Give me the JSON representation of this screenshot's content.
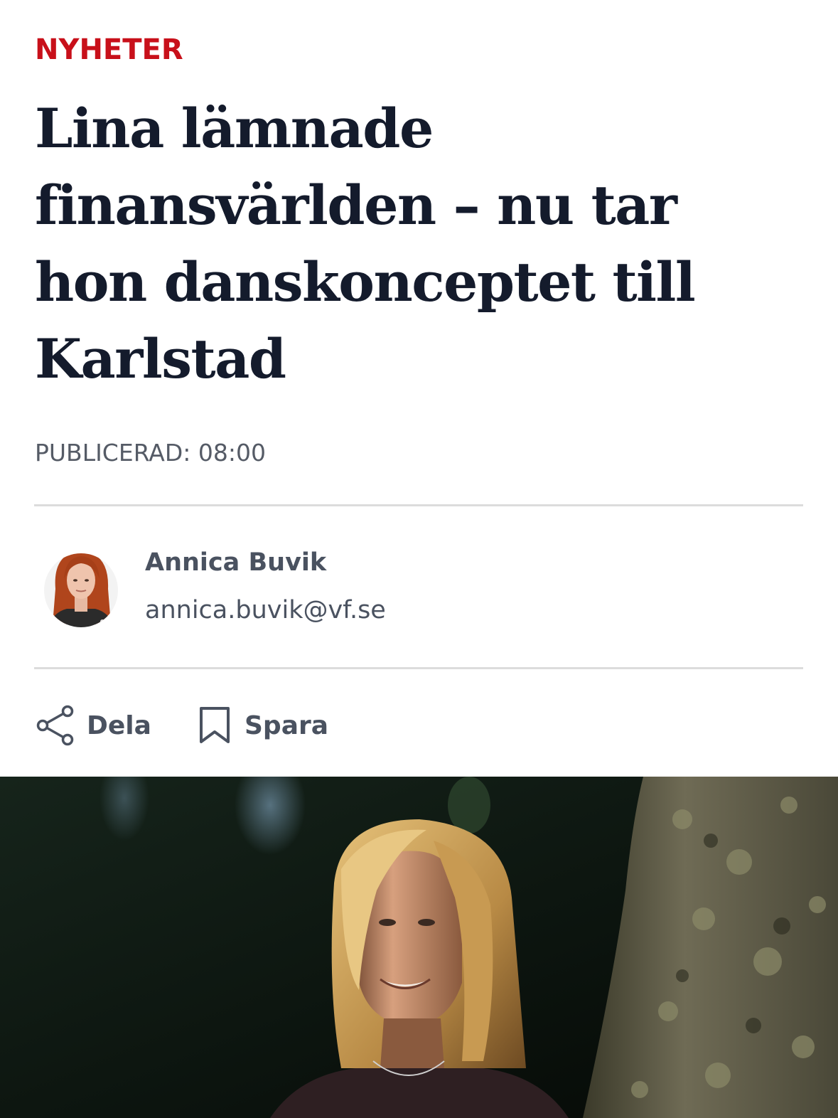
{
  "article": {
    "section": "NYHETER",
    "headline": "Lina lämnade finansvärlden – nu tar hon danskonceptet till Karlstad",
    "published": "PUBLICERAD: 08:00"
  },
  "author": {
    "name": "Annica Buvik",
    "email": "annica.buvik@vf.se"
  },
  "actions": {
    "share_label": "Dela",
    "save_label": "Spara"
  },
  "colors": {
    "section_accent": "#c8101a",
    "headline": "#141b2c",
    "meta_text": "#555b66",
    "divider": "#dcdcdc"
  },
  "icons": {
    "share": "share-icon",
    "save": "bookmark-icon"
  }
}
